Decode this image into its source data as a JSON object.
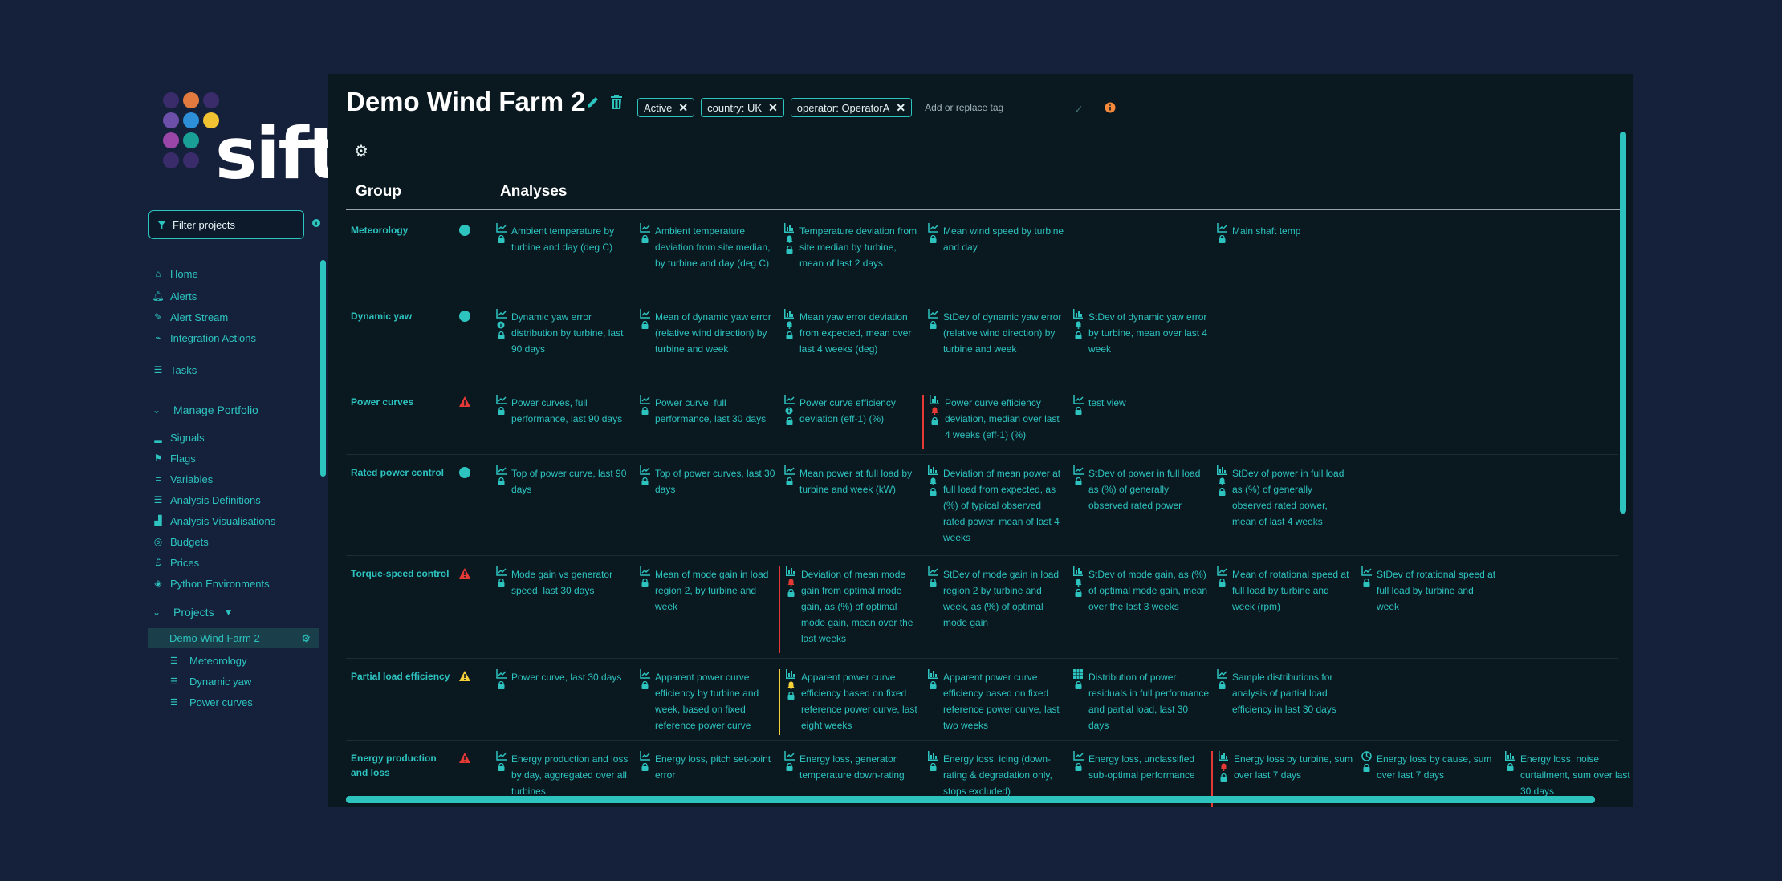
{
  "app": {
    "logo_text": "sift"
  },
  "sidebar": {
    "filter_placeholder": "Filter projects",
    "nav": [
      {
        "label": "Home",
        "icon": "home-icon"
      },
      {
        "label": "Alerts",
        "icon": "bell-icon"
      },
      {
        "label": "Alert Stream",
        "icon": "stream-icon"
      },
      {
        "label": "Integration Actions",
        "icon": "link-icon"
      },
      {
        "label": "Tasks",
        "icon": "list-icon"
      }
    ],
    "manage_section": "Manage Portfolio",
    "manage_items": [
      {
        "label": "Signals",
        "icon": "signal-icon"
      },
      {
        "label": "Flags",
        "icon": "flag-icon"
      },
      {
        "label": "Variables",
        "icon": "equals-icon"
      },
      {
        "label": "Analysis Definitions",
        "icon": "list-icon"
      },
      {
        "label": "Analysis Visualisations",
        "icon": "chart-icon"
      },
      {
        "label": "Budgets",
        "icon": "coins-icon"
      },
      {
        "label": "Prices",
        "icon": "pound-icon"
      },
      {
        "label": "Python Environments",
        "icon": "cube-icon"
      }
    ],
    "projects_section": "Projects",
    "current_project": "Demo Wind Farm 2",
    "project_groups": [
      "Meteorology",
      "Dynamic yaw",
      "Power curves"
    ]
  },
  "header": {
    "title": "Demo Wind Farm 2",
    "tags": [
      "Active",
      "country: UK",
      "operator: OperatorA"
    ],
    "tag_input_placeholder": "Add or replace tag"
  },
  "table": {
    "col_group": "Group",
    "col_analyses": "Analyses",
    "rows": [
      {
        "group": "Meteorology",
        "status": "ok",
        "cells": [
          {
            "col": 0,
            "text": "Ambient temperature by turbine and day (deg C)",
            "icon": "line",
            "extra": "lock"
          },
          {
            "col": 1,
            "text": "Ambient temperature deviation from site median, by turbine and day (deg C)",
            "icon": "line",
            "extra": "lock"
          },
          {
            "col": 2,
            "text": "Temperature deviation from site median by turbine, mean of last 2 days",
            "icon": "bar",
            "extra": "bell-lock"
          },
          {
            "col": 3,
            "text": "Mean wind speed by turbine and day",
            "icon": "line",
            "extra": "lock"
          },
          {
            "col": 5,
            "text": "Main shaft temp",
            "icon": "line",
            "extra": "lock"
          }
        ]
      },
      {
        "group": "Dynamic yaw",
        "status": "ok",
        "cells": [
          {
            "col": 0,
            "text": "Dynamic yaw error distribution by turbine, last 90 days",
            "icon": "line",
            "extra": "info-lock"
          },
          {
            "col": 1,
            "text": "Mean of dynamic yaw error (relative wind direction) by turbine and week",
            "icon": "line",
            "extra": "lock"
          },
          {
            "col": 2,
            "text": "Mean yaw error deviation from expected, mean over last 4 weeks (deg)",
            "icon": "bar",
            "extra": "bell-lock"
          },
          {
            "col": 3,
            "text": "StDev of dynamic yaw error (relative wind direction) by turbine and week",
            "icon": "line",
            "extra": "lock"
          },
          {
            "col": 4,
            "text": "StDev of dynamic yaw error by turbine, mean over last 4 week",
            "icon": "bar",
            "extra": "bell-lock"
          }
        ]
      },
      {
        "group": "Power curves",
        "status": "alert",
        "cells": [
          {
            "col": 0,
            "text": "Power curves, full performance, last 90 days",
            "icon": "line",
            "extra": "lock"
          },
          {
            "col": 1,
            "text": "Power curve, full performance, last 30 days",
            "icon": "line",
            "extra": "lock"
          },
          {
            "col": 2,
            "text": "Power curve efficiency deviation (eff-1) (%)",
            "icon": "line",
            "extra": "info-lock"
          },
          {
            "col": 3,
            "text": "Power curve efficiency deviation, median over last 4 weeks (eff-1) (%)",
            "icon": "bar",
            "extra": "redbell-lock",
            "bar": "red"
          },
          {
            "col": 4,
            "text": "test view",
            "icon": "line",
            "extra": "lock"
          }
        ]
      },
      {
        "group": "Rated power control",
        "status": "ok",
        "cells": [
          {
            "col": 0,
            "text": "Top of power curve, last 90 days",
            "icon": "line",
            "extra": "lock"
          },
          {
            "col": 1,
            "text": "Top of power curves, last 30 days",
            "icon": "line",
            "extra": "lock"
          },
          {
            "col": 2,
            "text": "Mean power at full load by turbine and week (kW)",
            "icon": "line",
            "extra": "lock"
          },
          {
            "col": 3,
            "text": "Deviation of mean power at full load from expected, as (%) of typical observed rated power, mean of last 4 weeks",
            "icon": "bar",
            "extra": "bell-lock"
          },
          {
            "col": 4,
            "text": "StDev of power in full load as (%) of generally observed rated power",
            "icon": "line",
            "extra": "lock"
          },
          {
            "col": 5,
            "text": "StDev of power in full load as (%) of generally observed rated power, mean of last 4 weeks",
            "icon": "bar",
            "extra": "bell-lock"
          }
        ]
      },
      {
        "group": "Torque-speed control",
        "status": "alert",
        "cells": [
          {
            "col": 0,
            "text": "Mode gain vs generator speed, last 30 days",
            "icon": "line",
            "extra": "lock"
          },
          {
            "col": 1,
            "text": "Mean of mode gain in load region 2, by turbine and week",
            "icon": "line",
            "extra": "lock"
          },
          {
            "col": 2,
            "text": "Deviation of mean mode gain from optimal mode gain, as (%) of optimal mode gain, mean over the last weeks",
            "icon": "bar",
            "extra": "redbell-lock",
            "bar": "red"
          },
          {
            "col": 3,
            "text": "StDev of mode gain in load region 2 by turbine and week, as (%) of optimal mode gain",
            "icon": "line",
            "extra": "lock"
          },
          {
            "col": 4,
            "text": "StDev of mode gain, as (%) of optimal mode gain, mean over the last 3 weeks",
            "icon": "bar",
            "extra": "bell-lock"
          },
          {
            "col": 5,
            "text": "Mean of rotational speed at full load by turbine and week (rpm)",
            "icon": "line",
            "extra": "lock"
          },
          {
            "col": 6,
            "text": "StDev of rotational speed at full load by turbine and week",
            "icon": "line",
            "extra": "lock"
          }
        ]
      },
      {
        "group": "Partial load efficiency",
        "status": "warn",
        "cells": [
          {
            "col": 0,
            "text": "Power curve, last 30 days",
            "icon": "line",
            "extra": "lock"
          },
          {
            "col": 1,
            "text": "Apparent power curve efficiency by turbine and week, based on fixed reference power curve",
            "icon": "line",
            "extra": "lock"
          },
          {
            "col": 2,
            "text": "Apparent power curve efficiency based on fixed reference power curve, last eight weeks",
            "icon": "bar",
            "extra": "yellowbell-lock",
            "bar": "yellow"
          },
          {
            "col": 3,
            "text": "Apparent power curve efficiency based on fixed reference power curve, last two weeks",
            "icon": "bar",
            "extra": "lock"
          },
          {
            "col": 4,
            "text": "Distribution of power residuals in full performance and partial load, last 30 days",
            "icon": "grid",
            "extra": "lock"
          },
          {
            "col": 5,
            "text": "Sample distributions for analysis of partial load efficiency in last 30 days",
            "icon": "line",
            "extra": "lock"
          }
        ]
      },
      {
        "group": "Energy production and loss",
        "status": "alert",
        "cells": [
          {
            "col": 0,
            "text": "Energy production and loss by day, aggregated over all turbines",
            "icon": "line",
            "extra": "lock"
          },
          {
            "col": 1,
            "text": "Energy loss, pitch set-point error",
            "icon": "line",
            "extra": "lock"
          },
          {
            "col": 2,
            "text": "Energy loss, generator temperature down-rating",
            "icon": "line",
            "extra": "lock"
          },
          {
            "col": 3,
            "text": "Energy loss, icing (down-rating & degradation only, stops excluded)",
            "icon": "bar",
            "extra": "lock"
          },
          {
            "col": 4,
            "text": "Energy loss, unclassified sub-optimal performance",
            "icon": "line",
            "extra": "lock"
          },
          {
            "col": 5,
            "text": "Energy loss by turbine, sum over last 7 days",
            "icon": "bar",
            "extra": "redbell-lock",
            "bar": "red"
          },
          {
            "col": 6,
            "text": "Energy loss by cause, sum over last 7 days",
            "icon": "pie",
            "extra": "lock"
          },
          {
            "col": 7,
            "text": "Energy loss, noise curtailment, sum over last 30 days",
            "icon": "bar",
            "extra": "lock"
          }
        ]
      }
    ]
  },
  "colors": {
    "accent": "#2dc4c0",
    "alert": "#e53935",
    "warn": "#f5d23a",
    "info": "#f58a3a"
  }
}
